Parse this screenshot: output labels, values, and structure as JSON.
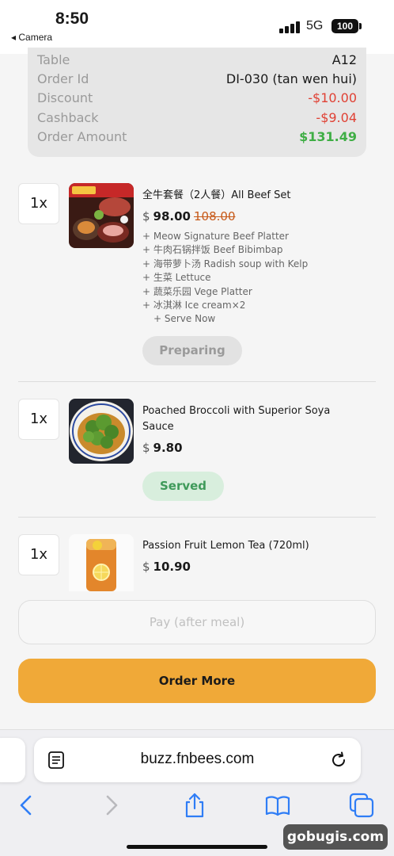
{
  "status_bar": {
    "time": "8:50",
    "back_app": "◂ Camera",
    "network": "5G",
    "battery": "100"
  },
  "summary": {
    "rows": [
      {
        "label": "Table",
        "value": "A12"
      },
      {
        "label": "Order Id",
        "value": "DI-030 (tan wen hui)"
      },
      {
        "label": "Discount",
        "value": "-$10.00"
      },
      {
        "label": "Cashback",
        "value": "-$9.04"
      },
      {
        "label": "Order Amount",
        "value": "$131.49"
      }
    ],
    "colors": {
      "negative": "#e04134",
      "total": "#3fae45"
    }
  },
  "items": [
    {
      "qty": "1x",
      "name": "全牛套餐（2人餐）All Beef Set",
      "currency": "$",
      "price": "98.00",
      "old_price": "108.00",
      "modifiers": [
        "+ Meow Signature Beef Platter",
        "+ 牛肉石锅拌饭 Beef Bibimbap",
        "+ 海带萝卜汤 Radish soup with Kelp",
        "+ 生菜 Lettuce",
        "+ 蔬菜乐园 Vege Platter",
        "+ 冰淇淋 Ice cream×2",
        "+ Serve Now"
      ],
      "status": "Preparing"
    },
    {
      "qty": "1x",
      "name_line1": "Poached Broccoli with Superior Soya",
      "name_line2": "Sauce",
      "currency": "$",
      "price": "9.80",
      "status": "Served"
    },
    {
      "qty": "1x",
      "name": "Passion Fruit Lemon Tea (720ml)",
      "currency": "$",
      "price": "10.90"
    }
  ],
  "buttons": {
    "pay": "Pay (after meal)",
    "order_more": "Order More",
    "accent": "#f0a938"
  },
  "browser": {
    "url": "buzz.fnbees.com",
    "icons": [
      "reader-icon",
      "reload-icon",
      "back-icon",
      "forward-icon",
      "share-icon",
      "bookmarks-icon",
      "tabs-icon"
    ]
  },
  "watermark": "gobugis.com"
}
